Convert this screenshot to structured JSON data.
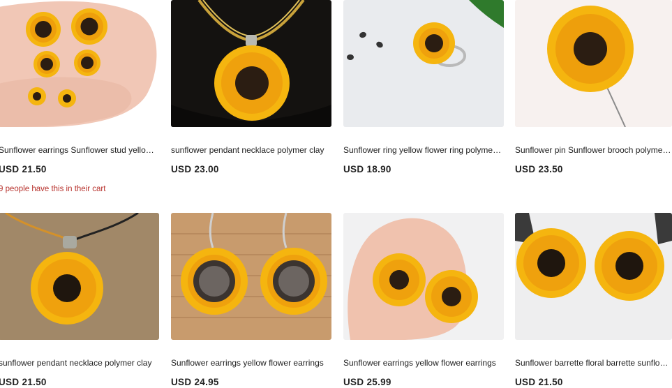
{
  "listings": [
    {
      "title": "Sunflower earrings Sunflower stud yellow flower earrings",
      "price": "USD 21.50",
      "cart_note": "9 people have this in their cart",
      "image": "sunflower-stud-earrings-on-hand"
    },
    {
      "title": "sunflower pendant necklace polymer clay",
      "price": "USD 23.00",
      "image": "sunflower-pendant-on-black-bust"
    },
    {
      "title": "Sunflower ring yellow flower ring polymer clay",
      "price": "USD 18.90",
      "image": "sunflower-ring-with-seeds"
    },
    {
      "title": "Sunflower pin Sunflower brooch polymer clay",
      "price": "USD 23.50",
      "image": "sunflower-brooch-pin"
    },
    {
      "title": "sunflower pendant necklace polymer clay",
      "price": "USD 21.50",
      "image": "sunflower-pendant-on-burlap"
    },
    {
      "title": "Sunflower earrings yellow flower earrings",
      "price": "USD 24.95",
      "image": "sunflower-rhinestone-earrings-on-wood"
    },
    {
      "title": "Sunflower earrings yellow flower earrings",
      "price": "USD 25.99",
      "image": "sunflower-earrings-on-palm"
    },
    {
      "title": "Sunflower barrette floral barrette sunflower",
      "price": "USD 21.50",
      "image": "sunflower-barrette-pair"
    }
  ],
  "colors": {
    "petal": "#f5b50f",
    "petal_dark": "#e8890a",
    "center": "#2b1d12",
    "cart_note": "#b7312c"
  }
}
